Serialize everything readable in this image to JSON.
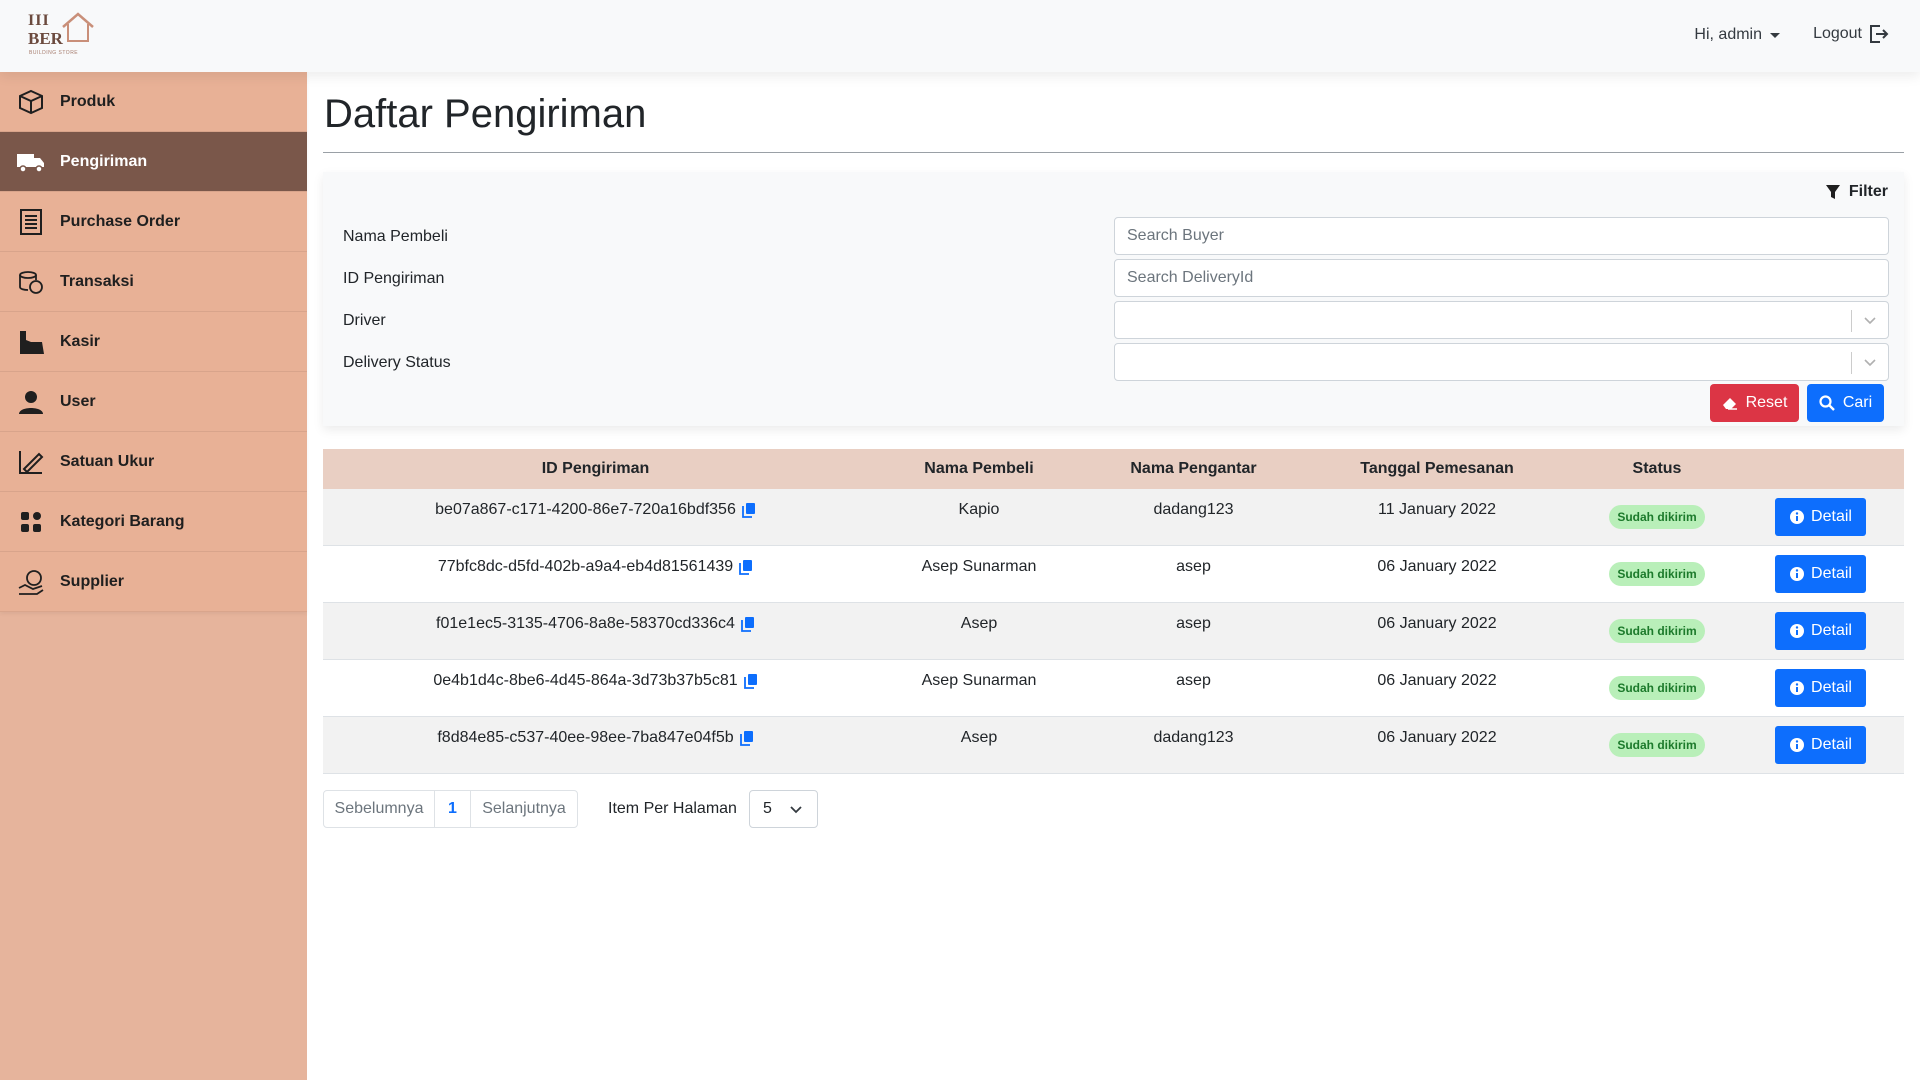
{
  "header": {
    "logo_line1": "III",
    "logo_line2": "BER",
    "logo_line3": "BUILDING STORE",
    "greeting": "Hi, admin",
    "logout_label": "Logout"
  },
  "sidebar": {
    "items": [
      {
        "label": "Produk",
        "icon": "box-icon"
      },
      {
        "label": "Pengiriman",
        "icon": "truck-icon",
        "active": true
      },
      {
        "label": "Purchase Order",
        "icon": "order-list-icon"
      },
      {
        "label": "Transaksi",
        "icon": "coins-icon"
      },
      {
        "label": "Kasir",
        "icon": "cashier-icon"
      },
      {
        "label": "User",
        "icon": "user-icon"
      },
      {
        "label": "Satuan Ukur",
        "icon": "ruler-pencil-icon"
      },
      {
        "label": "Kategori Barang",
        "icon": "grid-icon"
      },
      {
        "label": "Supplier",
        "icon": "supplier-icon"
      }
    ]
  },
  "page": {
    "title": "Daftar Pengiriman"
  },
  "filter": {
    "heading": "Filter",
    "fields": {
      "buyer_label": "Nama Pembeli",
      "buyer_placeholder": "Search Buyer",
      "delivery_id_label": "ID Pengiriman",
      "delivery_id_placeholder": "Search DeliveryId",
      "driver_label": "Driver",
      "status_label": "Delivery Status"
    },
    "reset_label": "Reset",
    "search_label": "Cari"
  },
  "table": {
    "headers": [
      "ID Pengiriman",
      "Nama Pembeli",
      "Nama Pengantar",
      "Tanggal Pemesanan",
      "Status",
      ""
    ],
    "rows": [
      {
        "id": "be07a867-c171-4200-86e7-720a16bdf356",
        "buyer": "Kapio",
        "driver": "dadang123",
        "date": "11 January 2022",
        "status": "Sudah dikirim",
        "action": "Detail"
      },
      {
        "id": "77bfc8dc-d5fd-402b-a9a4-eb4d81561439",
        "buyer": "Asep Sunarman",
        "driver": "asep",
        "date": "06 January 2022",
        "status": "Sudah dikirim",
        "action": "Detail"
      },
      {
        "id": "f01e1ec5-3135-4706-8a8e-58370cd336c4",
        "buyer": "Asep",
        "driver": "asep",
        "date": "06 January 2022",
        "status": "Sudah dikirim",
        "action": "Detail"
      },
      {
        "id": "0e4b1d4c-8be6-4d45-864a-3d73b37b5c81",
        "buyer": "Asep Sunarman",
        "driver": "asep",
        "date": "06 January 2022",
        "status": "Sudah dikirim",
        "action": "Detail"
      },
      {
        "id": "f8d84e85-c537-40ee-98ee-7ba847e04f5b",
        "buyer": "Asep",
        "driver": "dadang123",
        "date": "06 January 2022",
        "status": "Sudah dikirim",
        "action": "Detail"
      }
    ]
  },
  "pagination": {
    "prev_label": "Sebelumnya",
    "current_page": "1",
    "next_label": "Selanjutnya",
    "per_page_label": "Item Per Halaman",
    "per_page_value": "5"
  },
  "colors": {
    "sidebar_bg": "#e6b49c",
    "sidebar_active": "#7a574a",
    "table_header_bg": "#e9cfc3",
    "primary": "#0d6efd",
    "danger": "#dc3545",
    "status_badge_bg": "#b9efb9"
  }
}
